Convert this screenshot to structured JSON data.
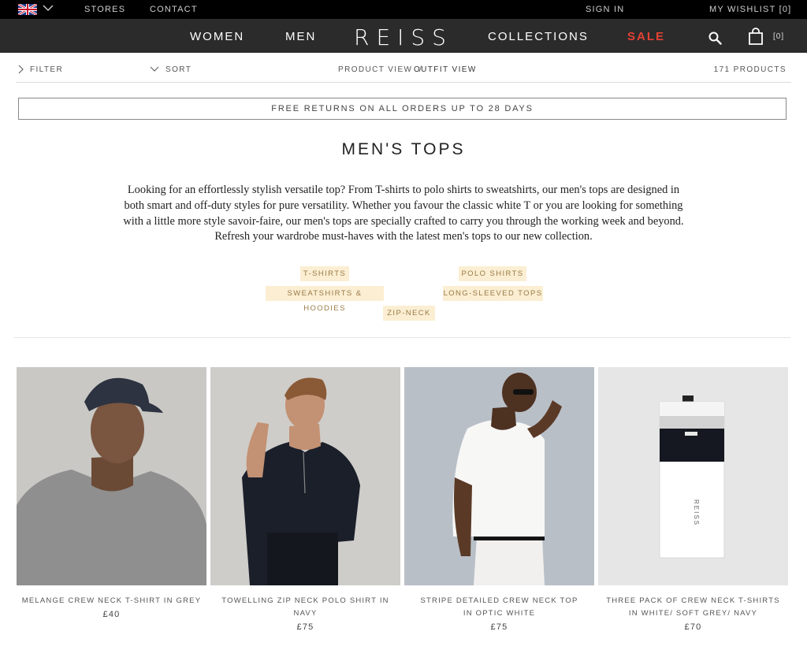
{
  "utility": {
    "stores": "STORES",
    "contact": "CONTACT",
    "sign_in": "SIGN IN",
    "wishlist": "MY WISHLIST [0]"
  },
  "nav": {
    "women": "WOMEN",
    "men": "MEN",
    "logo": "REISS",
    "collections": "COLLECTIONS",
    "sale": "SALE",
    "cart_count": "[0]",
    "sale_color": "#e34234"
  },
  "toolbar": {
    "filter": "FILTER",
    "sort": "SORT",
    "product_view": "PRODUCT VIEW",
    "separator": "/",
    "outfit_view": "OUTFIT VIEW",
    "product_count": "171 PRODUCTS"
  },
  "banner": {
    "text": "FREE RETURNS ON ALL ORDERS UP TO 28 DAYS"
  },
  "page": {
    "title": "MEN'S TOPS",
    "description": "Looking for an effortlessly stylish versatile top? From T-shirts to polo shirts to sweatshirts, our men's tops are designed in both smart and off-duty styles for pure versatility. Whether you favour the classic white T or you are looking for something with a little more style savoir-faire, our men's tops are specially crafted to carry you through the working week and beyond. Refresh your wardrobe must-haves with the latest men's tops to our new collection."
  },
  "categories": [
    {
      "label": "T-SHIRTS"
    },
    {
      "label": "POLO SHIRTS"
    },
    {
      "label": "SWEATSHIRTS & HOODIES"
    },
    {
      "label": "LONG-SLEEVED TOPS"
    },
    {
      "label": "ZIP-NECK"
    }
  ],
  "products": [
    {
      "name_line1": "MELANGE CREW NECK T-SHIRT IN GREY",
      "name_line2": "",
      "price": "£40"
    },
    {
      "name_line1": "TOWELLING ZIP NECK POLO SHIRT IN NAVY",
      "name_line2": "",
      "price": "£75"
    },
    {
      "name_line1": "STRIPE DETAILED CREW NECK TOP",
      "name_line2": "IN OPTIC WHITE",
      "price": "£75"
    },
    {
      "name_line1": "THREE PACK OF CREW NECK T-SHIRTS",
      "name_line2": "IN WHITE/ SOFT GREY/ NAVY",
      "price": "£70",
      "box_label": "REISS"
    }
  ]
}
